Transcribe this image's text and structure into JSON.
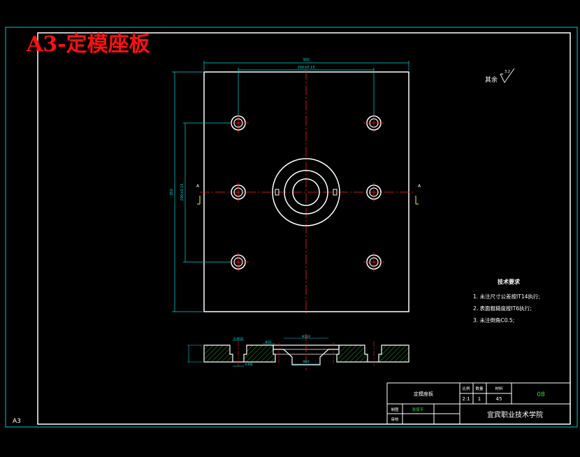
{
  "drawing": {
    "title": "A3-定模座板",
    "sheet_size": "A3",
    "roughness": {
      "label": "其余",
      "value": "3.2"
    },
    "dimensions": {
      "overall_width": "300",
      "hole_spacing_x": "200±0.15",
      "overall_height": "350",
      "hole_spacing_y": "290±0.15",
      "section_label": "A",
      "sec_dim_1": "4-Φ18",
      "sec_dim_2": "Φ120",
      "sec_dim_3": "Φ60",
      "sec_dim_4": "4-M8",
      "sec_dim_5": "Φ35"
    },
    "technical_requirements": {
      "heading": "技术要求",
      "items": [
        "1. 未注尺寸公差按IT14执行;",
        "2. 表面粗糙度按IT6执行;",
        "3. 未注倒角C0.5;"
      ]
    },
    "title_block": {
      "part_name": "定模座板",
      "scale_header": "比例",
      "quantity_header": "数量",
      "material_header": "材料",
      "scale": "2:1",
      "quantity": "1",
      "material": "45",
      "drawing_number": "08",
      "drawn_label": "制图",
      "drawn_by": "张保平",
      "checked_label": "审核",
      "school": "宜宾职业技术学院"
    }
  },
  "colors": {
    "background": "#000000",
    "frame": "#00c8c8",
    "outline": "#ffffff",
    "centerline": "#ff2020",
    "dimension": "#00d8d8",
    "hatch": "#2ea02e",
    "title": "#ff1010",
    "drawing_number": "#2ee02e"
  }
}
